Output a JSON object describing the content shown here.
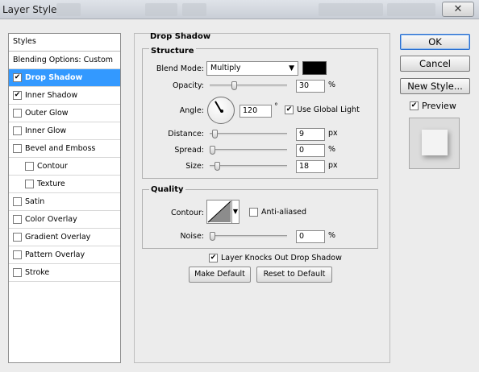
{
  "window": {
    "title": "Layer Style",
    "close_glyph": "✕"
  },
  "styles_list": {
    "header": "Styles",
    "items": [
      {
        "label": "Blending Options: Custom",
        "checkbox": false,
        "checked": false,
        "selected": false,
        "indent": false
      },
      {
        "label": "Drop Shadow",
        "checkbox": true,
        "checked": true,
        "selected": true,
        "indent": false
      },
      {
        "label": "Inner Shadow",
        "checkbox": true,
        "checked": true,
        "selected": false,
        "indent": false
      },
      {
        "label": "Outer Glow",
        "checkbox": true,
        "checked": false,
        "selected": false,
        "indent": false
      },
      {
        "label": "Inner Glow",
        "checkbox": true,
        "checked": false,
        "selected": false,
        "indent": false
      },
      {
        "label": "Bevel and Emboss",
        "checkbox": true,
        "checked": false,
        "selected": false,
        "indent": false
      },
      {
        "label": "Contour",
        "checkbox": true,
        "checked": false,
        "selected": false,
        "indent": true
      },
      {
        "label": "Texture",
        "checkbox": true,
        "checked": false,
        "selected": false,
        "indent": true
      },
      {
        "label": "Satin",
        "checkbox": true,
        "checked": false,
        "selected": false,
        "indent": false
      },
      {
        "label": "Color Overlay",
        "checkbox": true,
        "checked": false,
        "selected": false,
        "indent": false
      },
      {
        "label": "Gradient Overlay",
        "checkbox": true,
        "checked": false,
        "selected": false,
        "indent": false
      },
      {
        "label": "Pattern Overlay",
        "checkbox": true,
        "checked": false,
        "selected": false,
        "indent": false
      },
      {
        "label": "Stroke",
        "checkbox": true,
        "checked": false,
        "selected": false,
        "indent": false
      }
    ]
  },
  "drop_shadow": {
    "title": "Drop Shadow",
    "structure": {
      "title": "Structure",
      "blend_mode_label": "Blend Mode:",
      "blend_mode_value": "Multiply",
      "shadow_color": "#000000",
      "opacity_label": "Opacity:",
      "opacity_value": "30",
      "opacity_unit": "%",
      "opacity_fraction": 0.3,
      "angle_label": "Angle:",
      "angle_value": "120",
      "angle_unit": "°",
      "use_global_light_label": "Use Global Light",
      "use_global_light_checked": true,
      "distance_label": "Distance:",
      "distance_value": "9",
      "distance_unit": "px",
      "distance_fraction": 0.03,
      "spread_label": "Spread:",
      "spread_value": "0",
      "spread_unit": "%",
      "spread_fraction": 0.0,
      "size_label": "Size:",
      "size_value": "18",
      "size_unit": "px",
      "size_fraction": 0.07
    },
    "quality": {
      "title": "Quality",
      "contour_label": "Contour:",
      "anti_aliased_label": "Anti-aliased",
      "anti_aliased_checked": false,
      "noise_label": "Noise:",
      "noise_value": "0",
      "noise_unit": "%",
      "noise_fraction": 0.0
    },
    "knocks_out_label": "Layer Knocks Out Drop Shadow",
    "knocks_out_checked": true,
    "make_default_label": "Make Default",
    "reset_default_label": "Reset to Default"
  },
  "side_buttons": {
    "ok_label": "OK",
    "cancel_label": "Cancel",
    "new_style_label": "New Style...",
    "preview_label": "Preview",
    "preview_checked": true
  },
  "colors": {
    "selection": "#3399ff",
    "shadow": "#000000"
  },
  "icons": {
    "check": "✔",
    "dropdown": "▼"
  }
}
